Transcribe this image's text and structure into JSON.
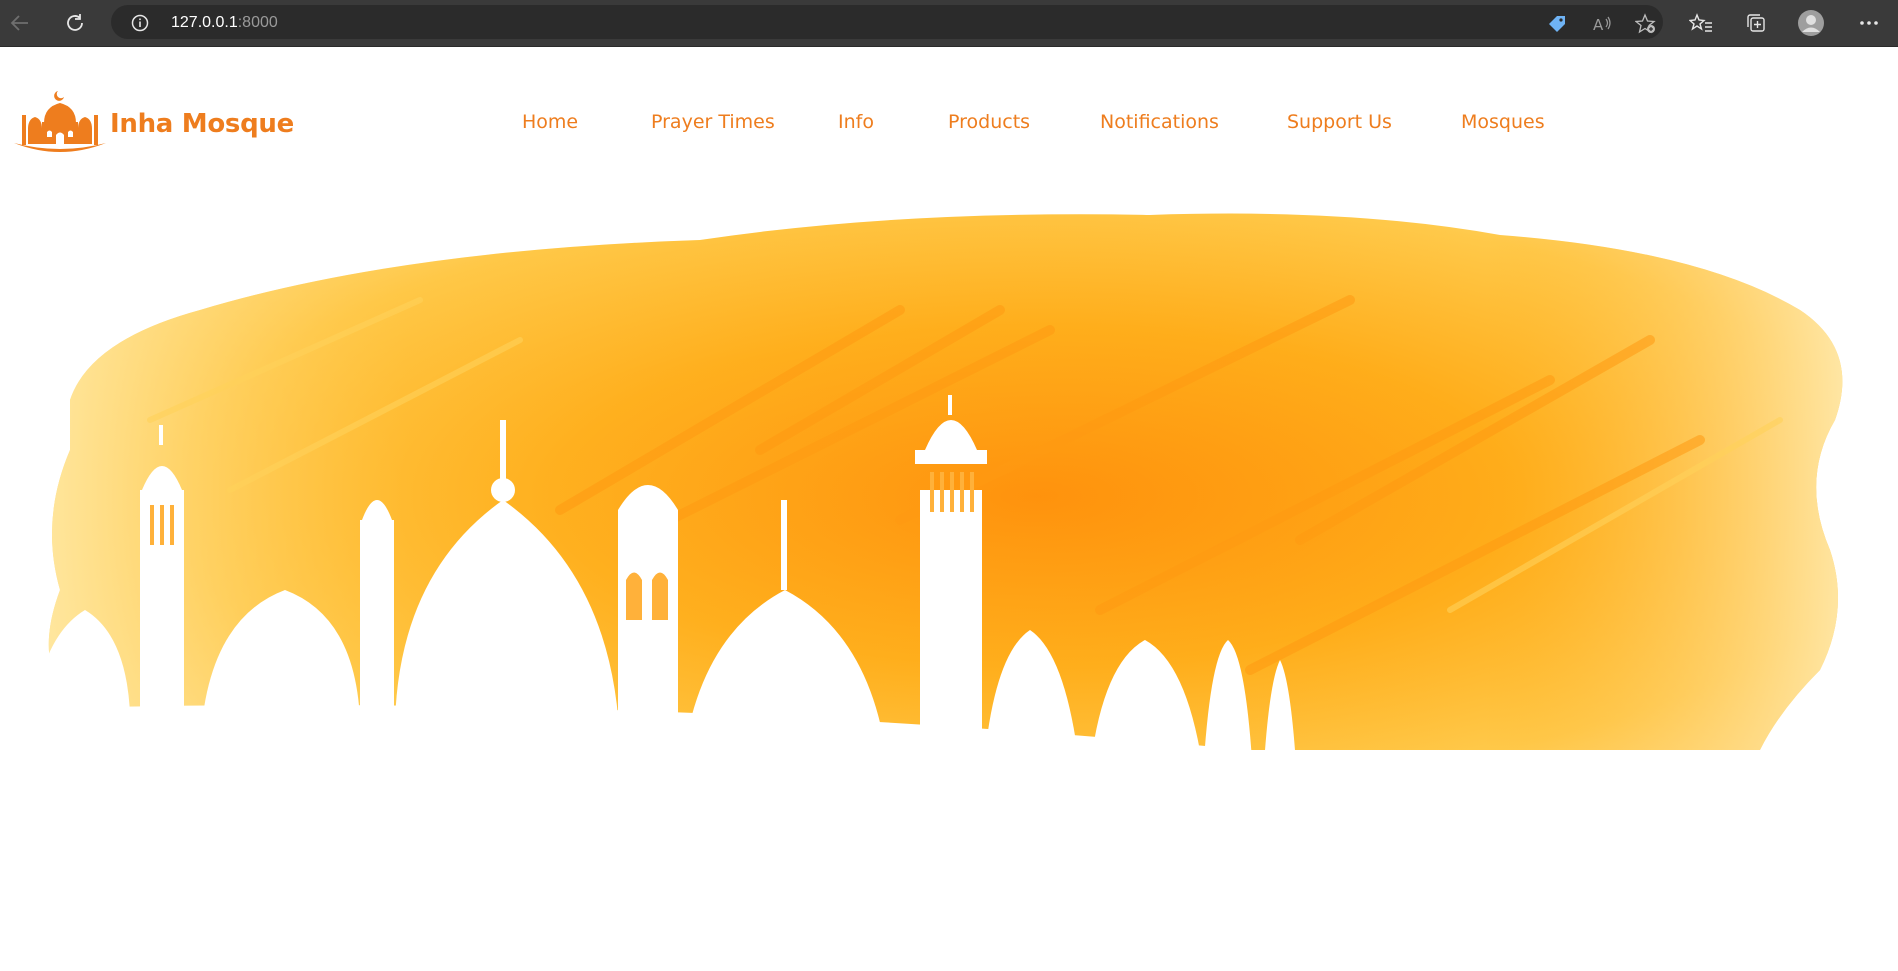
{
  "browser": {
    "url_host": "127.0.0.1",
    "url_port": ":8000"
  },
  "site": {
    "brand": "Inha Mosque",
    "nav": [
      {
        "label": "Home"
      },
      {
        "label": "Prayer Times"
      },
      {
        "label": "Info"
      },
      {
        "label": "Products"
      },
      {
        "label": "Notifications"
      },
      {
        "label": "Support Us"
      },
      {
        "label": "Mosques"
      }
    ]
  },
  "colors": {
    "brand_orange": "#ee7d1e",
    "chrome_bg": "#3a3a3a",
    "address_bg": "#2b2b2b"
  },
  "icons": {
    "back": "back-arrow-icon",
    "refresh": "refresh-icon",
    "info": "info-icon",
    "tag": "price-tag-icon",
    "read_aloud": "read-aloud-icon",
    "add_favorite": "add-favorite-icon",
    "favorites": "favorites-icon",
    "collections": "collections-icon",
    "profile": "profile-icon",
    "more": "more-icon"
  }
}
